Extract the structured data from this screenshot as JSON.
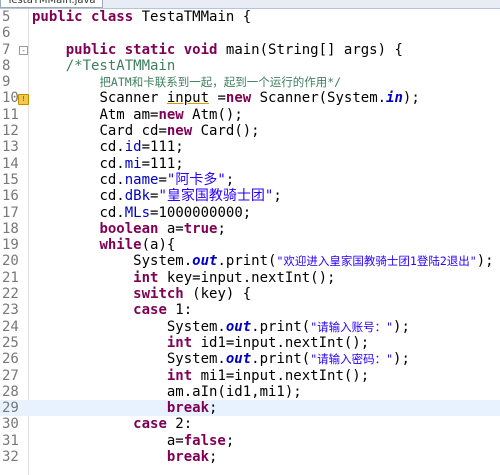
{
  "tab": {
    "title": "TestaTMMain.java"
  },
  "lines": [
    {
      "num": "5",
      "indent": "",
      "tokens": [
        {
          "t": "public",
          "c": "kw"
        },
        {
          "t": " "
        },
        {
          "t": "class",
          "c": "kw"
        },
        {
          "t": " TestaTMMain {"
        }
      ]
    },
    {
      "num": "6",
      "indent": "",
      "tokens": []
    },
    {
      "num": "7",
      "indent": "    ",
      "fold": "-",
      "tokens": [
        {
          "t": "public",
          "c": "kw"
        },
        {
          "t": " "
        },
        {
          "t": "static",
          "c": "kw"
        },
        {
          "t": " "
        },
        {
          "t": "void",
          "c": "kw"
        },
        {
          "t": " main(String[] args) {"
        }
      ]
    },
    {
      "num": "8",
      "indent": "    ",
      "tokens": [
        {
          "t": "/*TestATMMain",
          "c": "cm"
        }
      ]
    },
    {
      "num": "9",
      "indent": "        ",
      "tokens": [
        {
          "t": "把ATM和卡联系到一起，起到一个运行的作用*/",
          "c": "cm",
          "small": true
        }
      ]
    },
    {
      "num": "10",
      "indent": "        ",
      "marker": "!",
      "tokens": [
        {
          "t": "Scanner "
        },
        {
          "t": "input",
          "c": "uv"
        },
        {
          "t": " ="
        },
        {
          "t": "new",
          "c": "kw"
        },
        {
          "t": " Scanner(System."
        },
        {
          "t": "in",
          "c": "sf"
        },
        {
          "t": ");"
        }
      ]
    },
    {
      "num": "11",
      "indent": "        ",
      "tokens": [
        {
          "t": "Atm am="
        },
        {
          "t": "new",
          "c": "kw"
        },
        {
          "t": " Atm();"
        }
      ]
    },
    {
      "num": "12",
      "indent": "        ",
      "tokens": [
        {
          "t": "Card cd="
        },
        {
          "t": "new",
          "c": "kw"
        },
        {
          "t": " Card();"
        }
      ]
    },
    {
      "num": "13",
      "indent": "        ",
      "tokens": [
        {
          "t": "cd."
        },
        {
          "t": "id",
          "c": "fd"
        },
        {
          "t": "=111;"
        }
      ]
    },
    {
      "num": "14",
      "indent": "        ",
      "tokens": [
        {
          "t": "cd."
        },
        {
          "t": "mi",
          "c": "fd"
        },
        {
          "t": "=111;"
        }
      ]
    },
    {
      "num": "15",
      "indent": "        ",
      "tokens": [
        {
          "t": "cd."
        },
        {
          "t": "name",
          "c": "fd"
        },
        {
          "t": "="
        },
        {
          "t": "\"阿卡多\"",
          "c": "st"
        },
        {
          "t": ";"
        }
      ]
    },
    {
      "num": "16",
      "indent": "        ",
      "tokens": [
        {
          "t": "cd."
        },
        {
          "t": "dBk",
          "c": "fd"
        },
        {
          "t": "="
        },
        {
          "t": "\"皇家国教骑士团\"",
          "c": "st"
        },
        {
          "t": ";"
        }
      ]
    },
    {
      "num": "17",
      "indent": "        ",
      "tokens": [
        {
          "t": "cd."
        },
        {
          "t": "MLs",
          "c": "fd"
        },
        {
          "t": "=1000000000;"
        }
      ]
    },
    {
      "num": "18",
      "indent": "        ",
      "tokens": [
        {
          "t": "boolean",
          "c": "kw"
        },
        {
          "t": " a="
        },
        {
          "t": "true",
          "c": "kw"
        },
        {
          "t": ";"
        }
      ]
    },
    {
      "num": "19",
      "indent": "        ",
      "tokens": [
        {
          "t": "while",
          "c": "kw"
        },
        {
          "t": "(a){"
        }
      ]
    },
    {
      "num": "20",
      "indent": "            ",
      "tokens": [
        {
          "t": "System."
        },
        {
          "t": "out",
          "c": "sf"
        },
        {
          "t": ".print("
        },
        {
          "t": "\"欢迎进入皇家国教骑士团1登陆2退出\"",
          "c": "st",
          "small": true
        },
        {
          "t": ");"
        }
      ]
    },
    {
      "num": "21",
      "indent": "            ",
      "tokens": [
        {
          "t": "int",
          "c": "kw"
        },
        {
          "t": " key=input.nextInt();"
        }
      ]
    },
    {
      "num": "22",
      "indent": "            ",
      "tokens": [
        {
          "t": "switch",
          "c": "kw"
        },
        {
          "t": " (key) {"
        }
      ]
    },
    {
      "num": "23",
      "indent": "            ",
      "tokens": [
        {
          "t": "case",
          "c": "kw"
        },
        {
          "t": " 1:"
        }
      ]
    },
    {
      "num": "24",
      "indent": "                ",
      "tokens": [
        {
          "t": "System."
        },
        {
          "t": "out",
          "c": "sf"
        },
        {
          "t": ".print("
        },
        {
          "t": "\"请输入账号：\"",
          "c": "st",
          "small": true
        },
        {
          "t": ");"
        }
      ]
    },
    {
      "num": "25",
      "indent": "                ",
      "tokens": [
        {
          "t": "int",
          "c": "kw"
        },
        {
          "t": " id1=input.nextInt();"
        }
      ]
    },
    {
      "num": "26",
      "indent": "                ",
      "tokens": [
        {
          "t": "System."
        },
        {
          "t": "out",
          "c": "sf"
        },
        {
          "t": ".print("
        },
        {
          "t": "\"请输入密码：\"",
          "c": "st",
          "small": true
        },
        {
          "t": ");"
        }
      ]
    },
    {
      "num": "27",
      "indent": "                ",
      "tokens": [
        {
          "t": "int",
          "c": "kw"
        },
        {
          "t": " mi1=input.nextInt();"
        }
      ]
    },
    {
      "num": "28",
      "indent": "                ",
      "tokens": [
        {
          "t": "am.aIn(id1,mi1);"
        }
      ]
    },
    {
      "num": "29",
      "indent": "                ",
      "current": true,
      "tokens": [
        {
          "t": "break",
          "c": "kw"
        },
        {
          "t": ";"
        }
      ]
    },
    {
      "num": "30",
      "indent": "            ",
      "tokens": [
        {
          "t": "case",
          "c": "kw"
        },
        {
          "t": " 2:"
        }
      ]
    },
    {
      "num": "31",
      "indent": "                ",
      "tokens": [
        {
          "t": "a="
        },
        {
          "t": "false",
          "c": "kw"
        },
        {
          "t": ";"
        }
      ]
    },
    {
      "num": "32",
      "indent": "                ",
      "tokens": [
        {
          "t": "break",
          "c": "kw"
        },
        {
          "t": ";"
        }
      ]
    }
  ]
}
